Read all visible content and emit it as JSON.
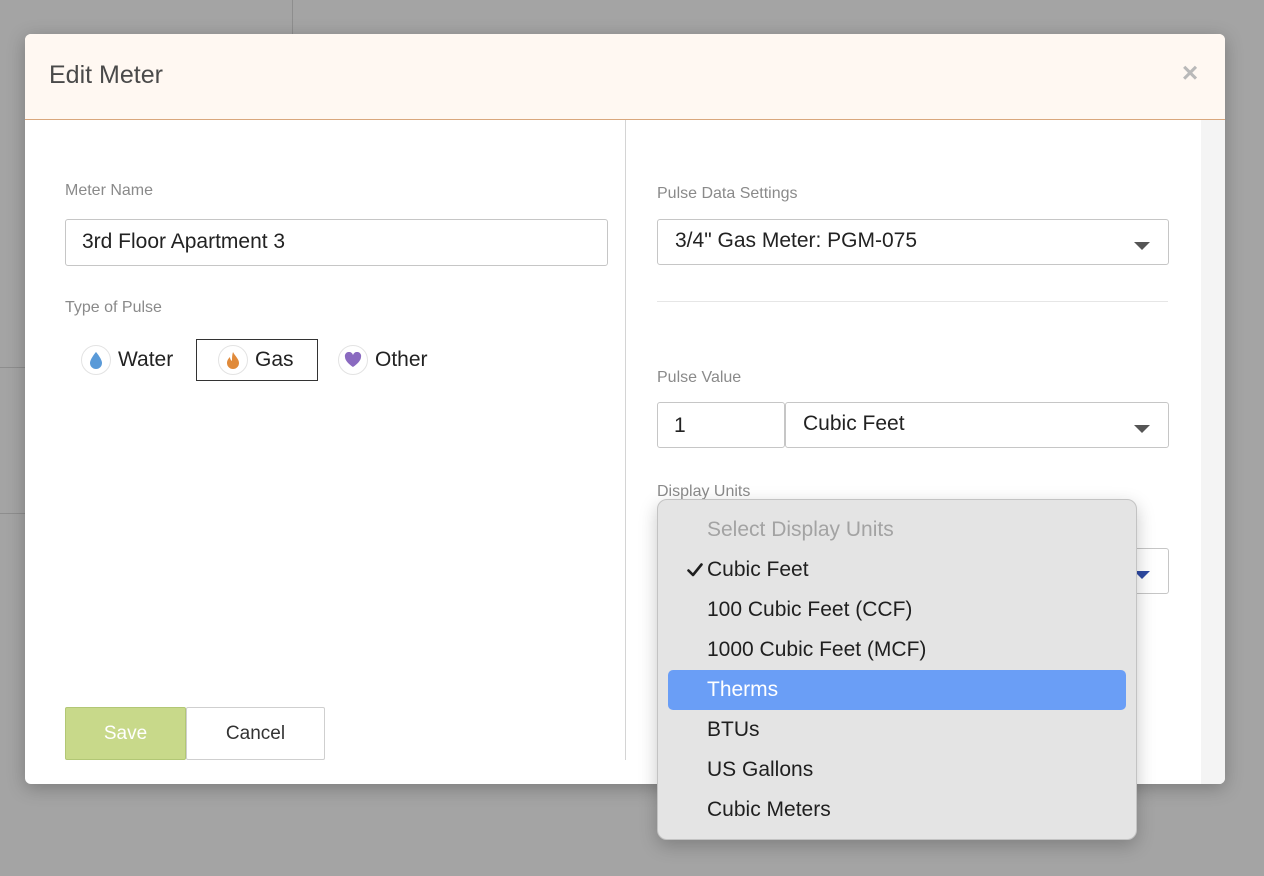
{
  "modal": {
    "title": "Edit Meter",
    "close_glyph": "×"
  },
  "left": {
    "meter_name_label": "Meter Name",
    "meter_name_value": "3rd Floor Apartment 3",
    "pulse_type_label": "Type of Pulse",
    "pulse_types": [
      {
        "label": "Water",
        "icon": "water-drop-icon",
        "color": "#5a9ad8",
        "selected": false
      },
      {
        "label": "Gas",
        "icon": "flame-icon",
        "color": "#e08a3a",
        "selected": true
      },
      {
        "label": "Other",
        "icon": "heart-icon",
        "color": "#8a6ac0",
        "selected": false
      }
    ],
    "save_label": "Save",
    "cancel_label": "Cancel"
  },
  "right": {
    "pulse_data_label": "Pulse Data Settings",
    "pulse_data_value": "3/4\" Gas Meter: PGM-075",
    "pulse_value_label": "Pulse Value",
    "pulse_value_number": "1",
    "pulse_value_unit": "Cubic Feet",
    "display_units_label": "Display Units"
  },
  "dropdown": {
    "options": [
      {
        "label": "Select Display Units",
        "state": "disabled"
      },
      {
        "label": "Cubic Feet",
        "state": "checked"
      },
      {
        "label": "100 Cubic Feet (CCF)",
        "state": "normal"
      },
      {
        "label": "1000 Cubic Feet (MCF)",
        "state": "normal"
      },
      {
        "label": "Therms",
        "state": "highlight"
      },
      {
        "label": "BTUs",
        "state": "normal"
      },
      {
        "label": "US Gallons",
        "state": "normal"
      },
      {
        "label": "Cubic Meters",
        "state": "normal"
      }
    ]
  },
  "colors": {
    "header_bg": "#fff8f2",
    "save_bg": "#c8d98a",
    "highlight": "#6a9ef6"
  }
}
